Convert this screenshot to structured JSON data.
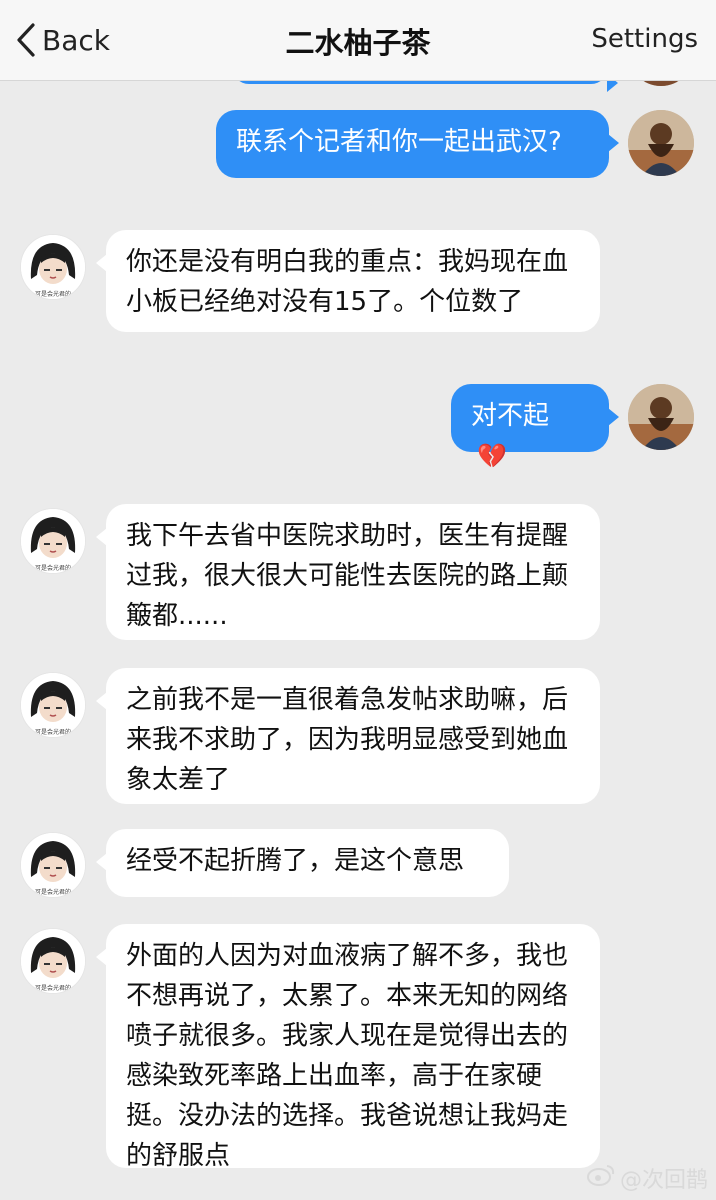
{
  "header": {
    "back_label": "Back",
    "title": "二水柚子茶",
    "settings_label": "Settings"
  },
  "messages": [
    {
      "sender": "self",
      "text": "联系个记者和你一起出武汉?"
    },
    {
      "sender": "other",
      "text": "你还是没有明白我的重点：我妈现在血小板已经绝对没有15了。个位数了"
    },
    {
      "sender": "self",
      "text": "对不起",
      "emoji": "💔"
    },
    {
      "sender": "other",
      "text": "我下午去省中医院求助时，医生有提醒过我，很大很大可能性去医院的路上颠簸都......"
    },
    {
      "sender": "other",
      "text": "之前我不是一直很着急发帖求助嘛，后来我不求助了，因为我明显感受到她血象太差了"
    },
    {
      "sender": "other",
      "text": "经受不起折腾了，是这个意思"
    },
    {
      "sender": "other",
      "text": "外面的人因为对血液病了解不多，我也不想再说了，太累了。本来无知的网络喷子就很多。我家人现在是觉得出去的感染致死率路上出血率，高于在家硬挺。没办法的选择。我爸说想让我妈走的舒服点"
    }
  ],
  "avatar_other_caption": "可是会光君的",
  "watermark": "@次回鹊",
  "colors": {
    "outgoing_bubble": "#2f8ff6",
    "incoming_bubble": "#ffffff",
    "background": "#ebebeb"
  }
}
